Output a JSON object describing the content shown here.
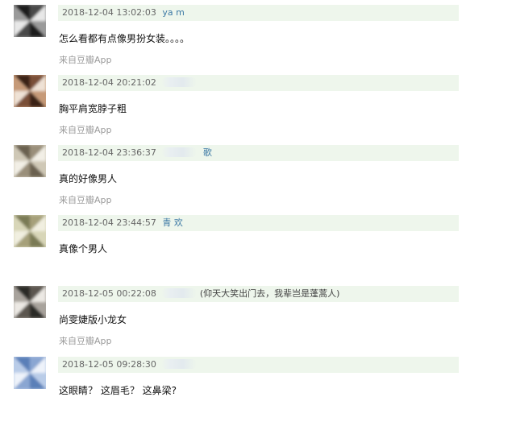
{
  "comments": [
    {
      "time": "2018-12-04 13:02:03",
      "author": "ya          m",
      "text": "怎么看都有点像男扮女装。。。。",
      "source": "来自豆瓣App",
      "avatar_colors": [
        "#1a1a1a",
        "#9a9a9a",
        "#e8e8e8",
        "#4a4a4a"
      ]
    },
    {
      "time": "2018-12-04 20:21:02",
      "author": "",
      "text": "胸平肩宽脖子粗",
      "source": "来自豆瓣App",
      "avatar_colors": [
        "#3a2418",
        "#c69a78",
        "#efe2d6",
        "#7a5038"
      ]
    },
    {
      "time": "2018-12-04 23:36:37",
      "author": "歌",
      "text": "真的好像男人",
      "source": "来自豆瓣App",
      "avatar_colors": [
        "#6b6050",
        "#cfc8b6",
        "#f2efe6",
        "#9a8f7a"
      ]
    },
    {
      "time": "2018-12-04 23:44:57",
      "author": "青      欢",
      "text": "真像个男人",
      "source": "",
      "avatar_colors": [
        "#7a7a54",
        "#d8d6b8",
        "#f1efe0",
        "#a6a07a"
      ]
    },
    {
      "time": "2018-12-05 00:22:08",
      "author": "(仰天大笑出门去，我辈岂是蓬蒿人)",
      "text": "尚雯婕版小龙女",
      "source": "来自豆瓣App",
      "avatar_colors": [
        "#2c2a28",
        "#a8a39c",
        "#ece9e4",
        "#5c5650"
      ]
    },
    {
      "time": "2018-12-05 09:28:30",
      "author": "",
      "text": "这眼睛？ 这眉毛？ 这鼻梁?",
      "source": "",
      "avatar_colors": [
        "#5a7fb8",
        "#b9cce8",
        "#eef3fa",
        "#8aa6d2"
      ]
    }
  ]
}
